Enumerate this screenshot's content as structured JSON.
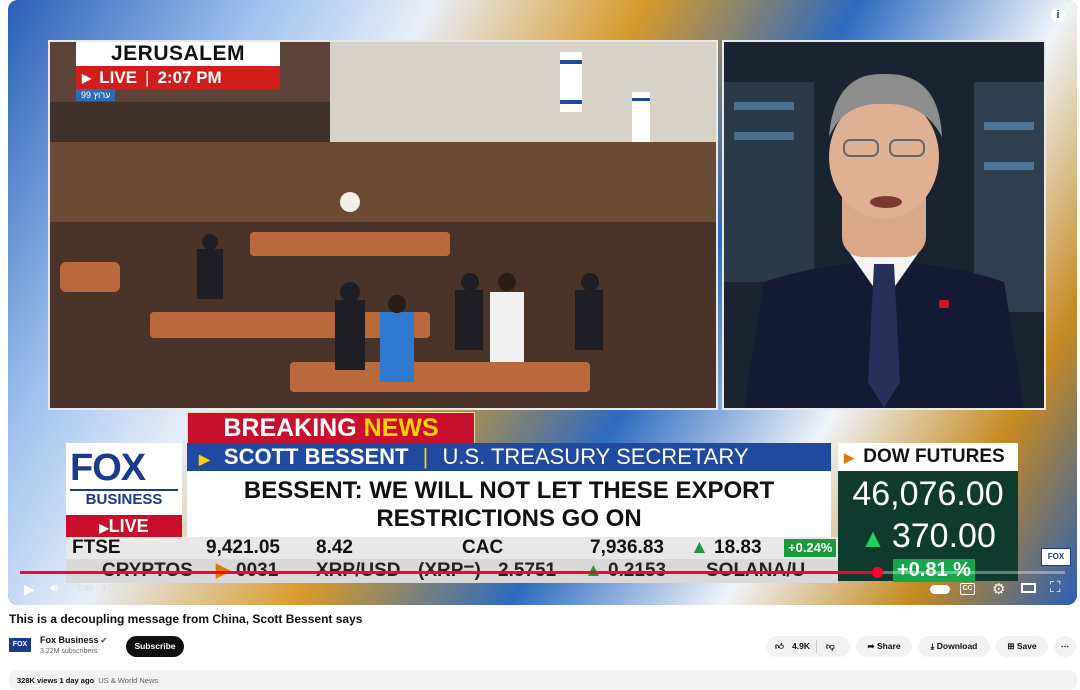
{
  "video": {
    "location_city": "JERUSALEM",
    "live_label": "LIVE",
    "live_time": "2:07 PM",
    "hebrew_tag": "99 ערוץ",
    "breaking_word1": "BREAKING",
    "breaking_word2": "NEWS",
    "fox_word": "FOX",
    "fox_business": "BUSINESS",
    "fox_live": "LIVE",
    "speaker_name": "SCOTT BESSENT",
    "speaker_title": "U.S. TREASURY SECRETARY",
    "headline_line1": "BESSENT: WE WILL NOT LET THESE EXPORT",
    "headline_line2": "RESTRICTIONS GO ON",
    "dow_label": "DOW FUTURES",
    "dow_value": "46,076.00",
    "dow_change": "370.00",
    "dow_pct": "+0.81 %",
    "ticker_top": {
      "left_code": "FTSE",
      "left_value": "9,421.05",
      "left_change": "8.42",
      "index_name": "CAC",
      "index_value": "7,936.83",
      "index_change": "18.83",
      "index_pct": "+0.24%"
    },
    "ticker_bottom": {
      "section": "CRYPTOS",
      "partial_value": "0031",
      "coin": "XRP/USD",
      "coin_code": "(XRP=)",
      "coin_value": "2.5751",
      "coin_change": "0.2153",
      "next_coin": "SOLANA/U"
    },
    "watermark": "FOX",
    "progress_fraction": 0.82
  },
  "player": {
    "time_current": "7:46",
    "time_total": "9:05",
    "time_sep": " / ",
    "info_icon": "i"
  },
  "meta": {
    "title": "This is a decoupling message from China, Scott Bessent says",
    "channel_logo": "FOX",
    "channel_name": "Fox Business",
    "subscribers": "3.22M subscribers",
    "subscribe_label": "Subscribe",
    "like_count": "4.9K",
    "share_label": "Share",
    "download_label": "Download",
    "save_label": "Save",
    "views": "328K views",
    "age": "1 day ago",
    "tag": "US & World News"
  }
}
